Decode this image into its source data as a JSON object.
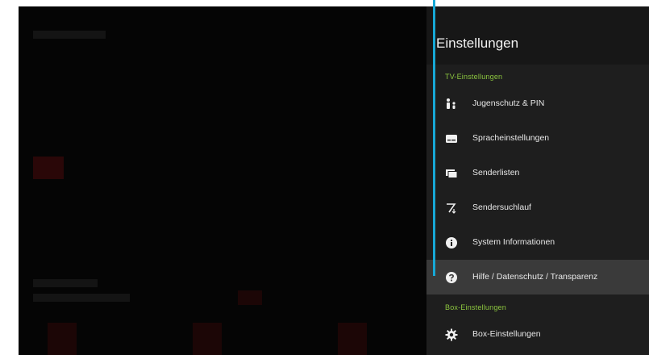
{
  "panel": {
    "title": "Einstellungen",
    "sections": [
      {
        "label": "TV-Einstellungen"
      },
      {
        "label": "Box-Einstellungen"
      }
    ],
    "items": [
      {
        "label": "Jugenschutz & PIN",
        "icon": "parental-control-icon"
      },
      {
        "label": "Spracheinstellungen",
        "icon": "subtitles-icon"
      },
      {
        "label": "Senderlisten",
        "icon": "channel-list-icon"
      },
      {
        "label": "Sendersuchlauf",
        "icon": "channel-scan-icon"
      },
      {
        "label": "System Informationen",
        "icon": "info-icon"
      },
      {
        "label": "Hilfe / Datenschutz / Transparenz",
        "icon": "help-icon"
      },
      {
        "label": "Box-Einstellungen",
        "icon": "gear-icon"
      }
    ],
    "selected_index": 5
  },
  "colors": {
    "accent_line": "#17a8d6",
    "section_label": "#8cc63f",
    "panel_bg": "#1e1e1e",
    "selected_bg": "#3a3a3a"
  }
}
